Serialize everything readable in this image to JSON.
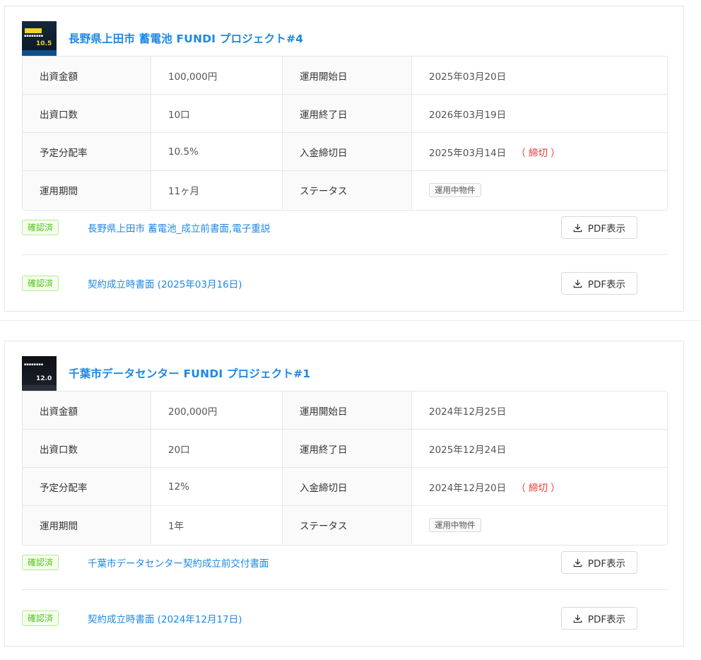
{
  "projects": [
    {
      "title": "長野県上田市 蓄電池 FUNDI プロジェクト#4",
      "thumbnail": {
        "rate": "10.5"
      },
      "rows": [
        {
          "label1": "出資金額",
          "value1": "100,000円",
          "label2": "運用開始日",
          "value2": "2025年03月20日"
        },
        {
          "label1": "出資口数",
          "value1": "10口",
          "label2": "運用終了日",
          "value2": "2026年03月19日"
        },
        {
          "label1": "予定分配率",
          "value1": "10.5%",
          "label2": "入金締切日",
          "value2": "2025年03月14日",
          "note": "（ 締切 ）"
        },
        {
          "label1": "運用期間",
          "value1": "11ヶ月",
          "label2": "ステータス",
          "status": "運用中物件"
        }
      ],
      "documents": [
        {
          "badge": "確認済",
          "link": "長野県上田市 蓄電池_成立前書面,電子重説",
          "button": "PDF表示"
        },
        {
          "badge": "確認済",
          "link": "契約成立時書面 (2025年03月16日)",
          "button": "PDF表示"
        }
      ]
    },
    {
      "title": "千葉市データセンター FUNDI プロジェクト#1",
      "thumbnail": {
        "rate": "12.0"
      },
      "rows": [
        {
          "label1": "出資金額",
          "value1": "200,000円",
          "label2": "運用開始日",
          "value2": "2024年12月25日"
        },
        {
          "label1": "出資口数",
          "value1": "20口",
          "label2": "運用終了日",
          "value2": "2025年12月24日"
        },
        {
          "label1": "予定分配率",
          "value1": "12%",
          "label2": "入金締切日",
          "value2": "2024年12月20日",
          "note": "（ 締切 ）"
        },
        {
          "label1": "運用期間",
          "value1": "1年",
          "label2": "ステータス",
          "status": "運用中物件"
        }
      ],
      "documents": [
        {
          "badge": "確認済",
          "link": "千葉市データセンター契約成立前交付書面",
          "button": "PDF表示"
        },
        {
          "badge": "確認済",
          "link": "契約成立時書面 (2024年12月17日)",
          "button": "PDF表示"
        }
      ]
    }
  ]
}
